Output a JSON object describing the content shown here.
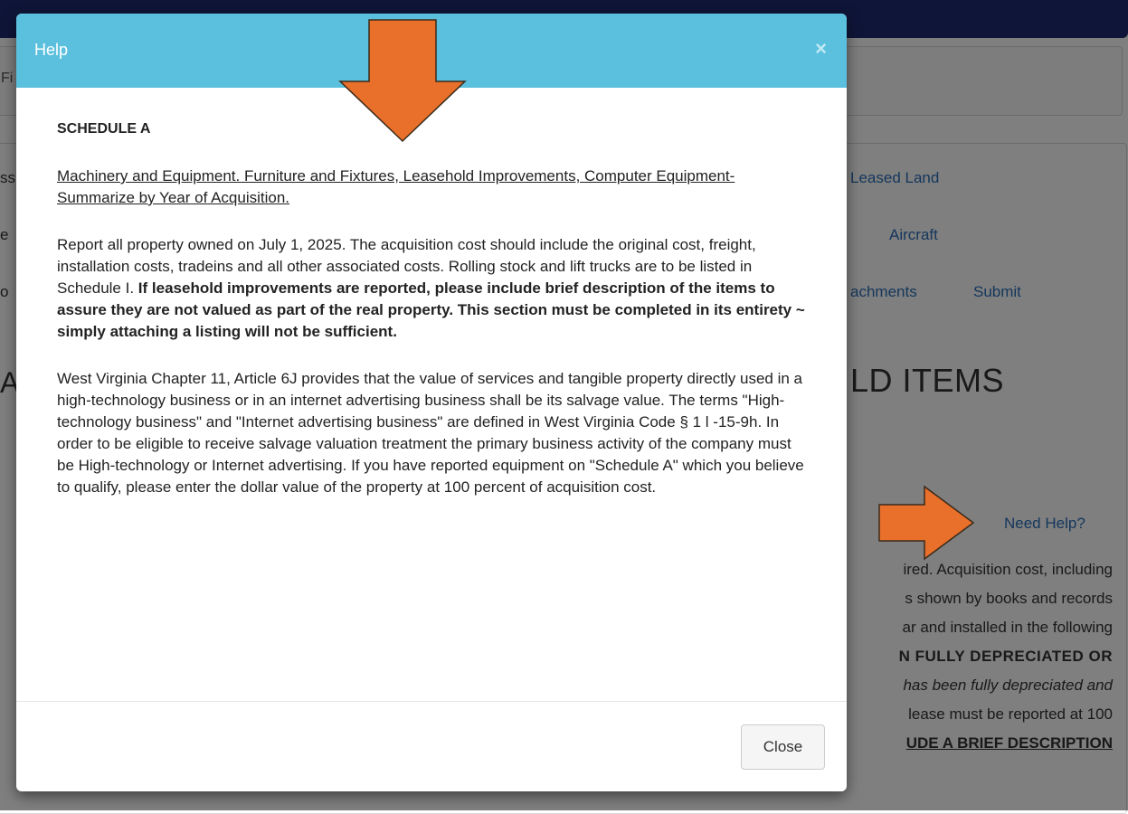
{
  "background": {
    "filter_edge_text": "Fi",
    "links": {
      "leased_land": "Leased Land",
      "aircraft": "Aircraft",
      "attachments": "achments",
      "submit": "Submit"
    },
    "left_edge": [
      "ss",
      "e",
      "o",
      "A"
    ],
    "heading": "LD ITEMS",
    "need_help": "Need Help?",
    "text_lines": [
      "ired. Acquisition cost, including",
      "s shown by books and records",
      "ar and installed in the following",
      "N FULLY DEPRECIATED OR",
      "has been fully depreciated and",
      "lease must be reported at 100",
      "UDE A BRIEF DESCRIPTION"
    ]
  },
  "modal": {
    "title": "Help",
    "close_x": "×",
    "section_title": "SCHEDULE A",
    "subtitle": "Machinery and Equipment. Furniture and Fixtures, Leasehold Improvements, Computer Equipment- Summarize by Year of Acquisition.",
    "para1_normal": "Report all property owned on July 1, 2025. The acquisition cost should include the original cost, freight, installation costs, tradeins and all other associated costs. Rolling stock and lift trucks are to be listed in Schedule I.",
    "para1_bold": "If leasehold improvements are reported, please include brief description of the items to assure they are not valued as part of the real property. This section must be completed in its entirety ~ simply attaching a listing will not be sufficient.",
    "para2": "West Virginia Chapter 11, Article 6J provides that the value of services and tangible property directly used in a high-technology business or in an internet advertising business shall be its salvage value. The terms \"High-technology business\" and \"Internet advertising business\" are defined in West Virginia Code § 1 l -15-9h. In order to be eligible to receive salvage valuation treatment the primary business activity of the company must be High-technology or Internet advertising. If you have reported equipment on \"Schedule A\" which you believe to qualify, please enter the dollar value of the property at 100 percent of acquisition cost.",
    "close_button": "Close"
  },
  "colors": {
    "navbar": "#1e2b70",
    "modal_header": "#5bc0de",
    "link": "#2a6fb8",
    "arrow_fill": "#e8702a"
  }
}
